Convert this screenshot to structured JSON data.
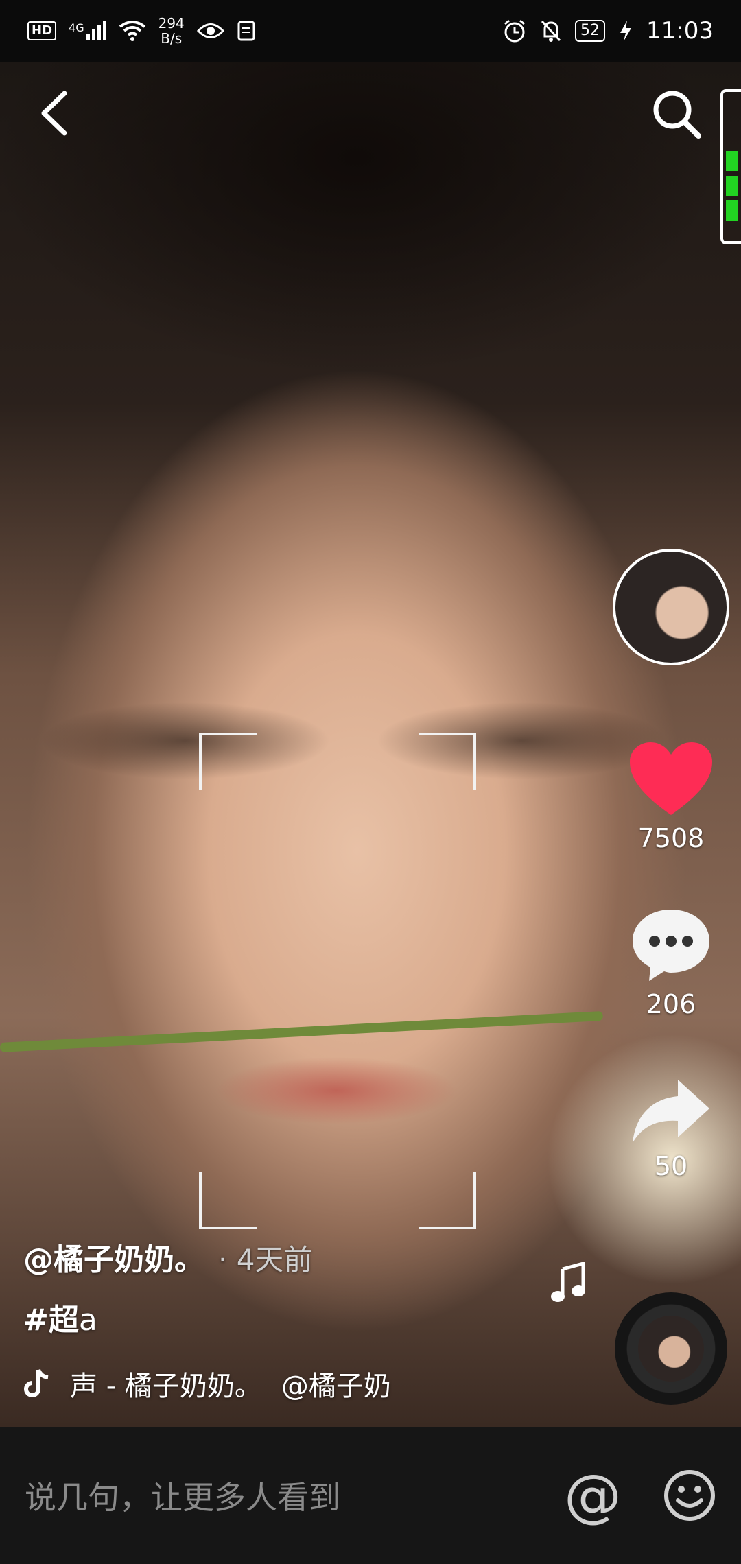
{
  "status_bar": {
    "hd": "HD",
    "network": "4G",
    "speed_value": "294",
    "speed_unit": "B/s",
    "battery": "52",
    "time": "11:03"
  },
  "video": {
    "author": "@橘子奶奶。",
    "time_ago": "· 4天前",
    "hashtag": "#超",
    "hashtag_suffix": "a",
    "music": "声 - 橘子奶奶。",
    "music_credit": "@橘子奶"
  },
  "actions": {
    "likes": "7508",
    "comments": "206",
    "shares": "50",
    "like_color": "#fe2c55"
  },
  "comment_bar": {
    "placeholder": "说几句，让更多人看到",
    "at_label": "@"
  }
}
